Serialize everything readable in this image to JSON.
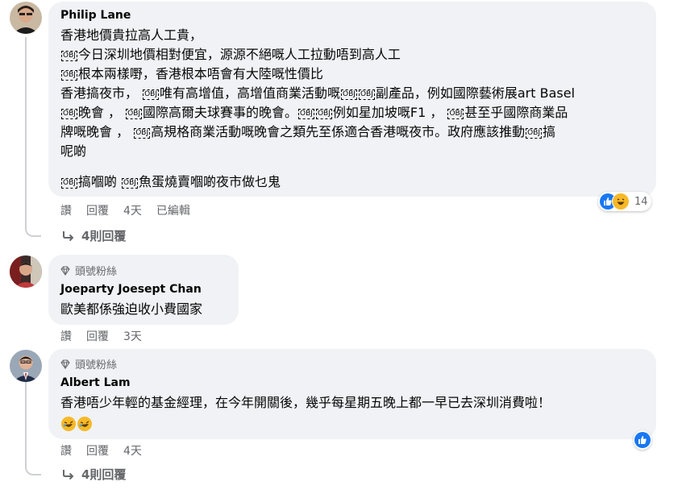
{
  "comments": [
    {
      "author": "Philip Lane",
      "lines": [
        [
          {
            "t": "香港地價貴拉高人工貴，"
          }
        ],
        [
          {
            "ob": "OBJ"
          },
          {
            "t": "今日深圳地價相對便宜，源源不絕嘅人工拉動唔到高人工"
          }
        ],
        [
          {
            "ob": "OBJ"
          },
          {
            "t": "根本兩樣嘢，香港根本唔會有大陸嘅性價比"
          }
        ],
        [
          {
            "t": "香港搞夜市， "
          },
          {
            "ob": "OBJ"
          },
          {
            "t": "唯有高增值，高增值商業活動嘅"
          },
          {
            "ob": "OBJ"
          },
          {
            "ob": "OBJ"
          },
          {
            "t": "副產品，例如國際藝術展art Basel"
          }
        ],
        [
          {
            "ob": "OBJ"
          },
          {
            "t": "晚會 ， "
          },
          {
            "ob": "OBJ"
          },
          {
            "t": "國際高爾夫球賽事的晚會。"
          },
          {
            "ob": "OBJ"
          },
          {
            "ob": "OBJ"
          },
          {
            "t": "例如星加坡嘅F1 ， "
          },
          {
            "ob": "OBJ"
          },
          {
            "t": "甚至乎國際商業品"
          }
        ],
        [
          {
            "t": "牌嘅晚會 ， "
          },
          {
            "ob": "OBJ"
          },
          {
            "t": "高規格商業活動嘅晚會之類先至係適合香港嘅夜市。政府應該推動"
          },
          {
            "ob": "OBJ"
          },
          {
            "t": "搞"
          }
        ],
        [
          {
            "t": "呢啲"
          }
        ],
        [
          {
            "ob": "OBJ"
          },
          {
            "t": "搞嗰啲 "
          },
          {
            "ob": "OBJ"
          },
          {
            "t": "魚蛋燒賣嗰啲夜市做乜鬼"
          }
        ]
      ],
      "actions": {
        "like": "讚",
        "reply": "回覆",
        "time": "4天",
        "edited": "已編輯"
      },
      "reactions": {
        "count": "14",
        "icons": [
          "like-icon",
          "haha-icon"
        ]
      },
      "replies_label": "4則回覆"
    },
    {
      "badge": "頭號粉絲",
      "author": "Joeparty Joesept Chan",
      "lines": [
        [
          {
            "t": "歐美都係強迫收小費國家"
          }
        ]
      ],
      "actions": {
        "like": "讚",
        "reply": "回覆",
        "time": "3天"
      }
    },
    {
      "badge": "頭號粉絲",
      "author": "Albert Lam",
      "lines": [
        [
          {
            "t": "香港唔少年輕的基金經理，在今年開關後，幾乎每星期五晚上都一早已去深圳消費啦！"
          }
        ]
      ],
      "emojis": [
        "rofl-icon",
        "rofl-icon"
      ],
      "actions": {
        "like": "讚",
        "reply": "回覆",
        "time": "4天"
      },
      "reactions": {
        "icons": [
          "like-icon"
        ]
      },
      "replies_label": "4則回覆"
    }
  ],
  "colors": {
    "bubble": "#f0f2f5",
    "meta": "#65676b",
    "like": "#1877f2",
    "haha": "#f7b928"
  }
}
